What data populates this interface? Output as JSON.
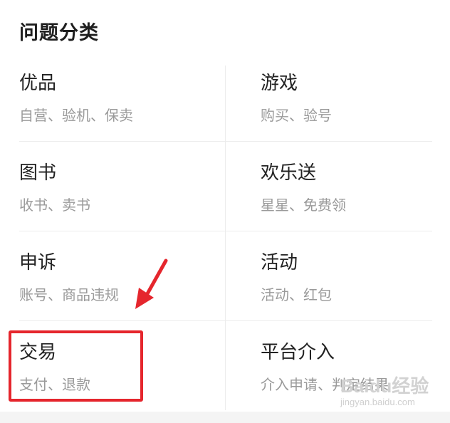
{
  "section_title": "问题分类",
  "categories": [
    {
      "name": "优品",
      "desc": "自营、验机、保卖"
    },
    {
      "name": "游戏",
      "desc": "购买、验号"
    },
    {
      "name": "图书",
      "desc": "收书、卖书"
    },
    {
      "name": "欢乐送",
      "desc": "星星、免费领"
    },
    {
      "name": "申诉",
      "desc": "账号、商品违规"
    },
    {
      "name": "活动",
      "desc": "活动、红包"
    },
    {
      "name": "交易",
      "desc": "支付、退款"
    },
    {
      "name": "平台介入",
      "desc": "介入申请、判定结果"
    }
  ],
  "annotation": {
    "color": "#e5262d",
    "highlighted_item": "交易"
  },
  "watermark": {
    "brand": "Baidu经验",
    "site": "jingyan.baidu.com"
  }
}
